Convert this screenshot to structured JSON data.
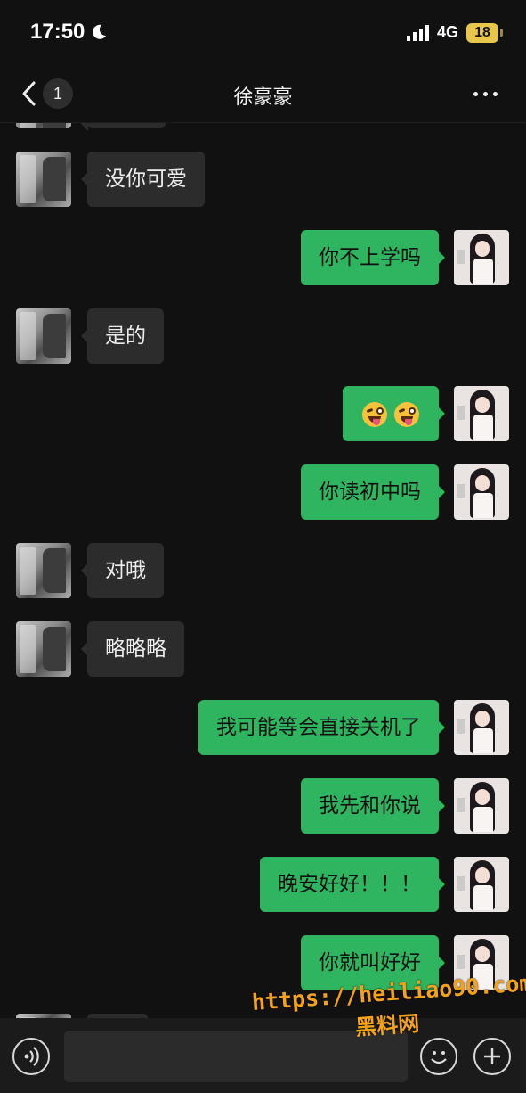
{
  "status_bar": {
    "time": "17:50",
    "network": "4G",
    "battery": "18"
  },
  "nav": {
    "unread_count": "1",
    "title": "徐豪豪"
  },
  "messages": [
    {
      "from": "friend",
      "text": "没你可爱"
    },
    {
      "from": "self",
      "text": "你不上学吗"
    },
    {
      "from": "friend",
      "text": "是的"
    },
    {
      "from": "self",
      "emoji": [
        "winking-tongue-emoji",
        "winking-tongue-emoji"
      ]
    },
    {
      "from": "self",
      "text": "你读初中吗"
    },
    {
      "from": "friend",
      "text": "对哦"
    },
    {
      "from": "friend",
      "text": "略略略"
    },
    {
      "from": "self",
      "text": "我可能等会直接关机了"
    },
    {
      "from": "self",
      "text": "我先和你说"
    },
    {
      "from": "self",
      "text": "晚安好好！！！"
    },
    {
      "from": "self",
      "text": "你就叫好好"
    }
  ],
  "input_bar": {
    "icons": [
      "voice-icon",
      "emoji-icon",
      "plus-icon"
    ]
  },
  "watermark": {
    "url": "https://heiliao90.com",
    "name": "黑料网"
  },
  "colors": {
    "background": "#111111",
    "outgoing_bubble": "#2fb55f",
    "incoming_bubble": "#2c2c2c",
    "watermark": "#f3a21a"
  }
}
